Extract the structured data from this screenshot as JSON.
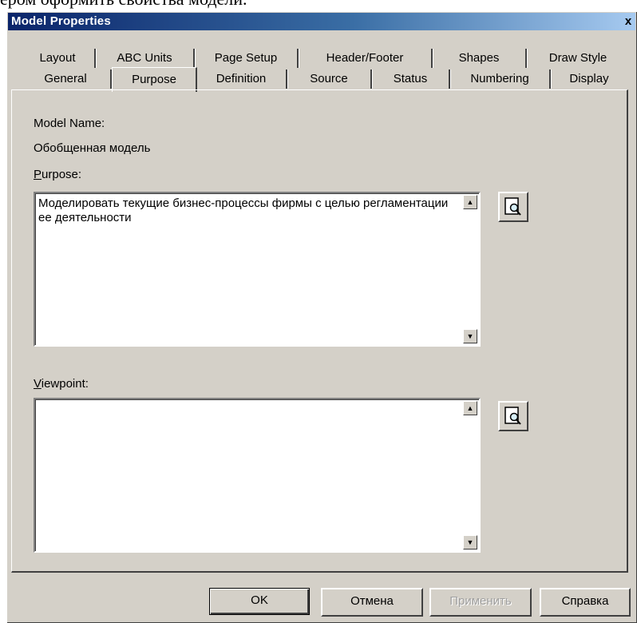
{
  "page_caption": "ером оформить свойства модели.",
  "dialog": {
    "title": "Model Properties",
    "close_glyph": "x"
  },
  "tabs": {
    "row_back": [
      "Layout",
      "ABC Units",
      "Page Setup",
      "Header/Footer",
      "Shapes",
      "Draw Style"
    ],
    "row_front": [
      "General",
      "Purpose",
      "Definition",
      "Source",
      "Status",
      "Numbering",
      "Display"
    ],
    "active": "Purpose"
  },
  "model_name": {
    "label": "Model Name:",
    "value": "Обобщенная модель"
  },
  "purpose": {
    "label_mnemonic": "P",
    "label_rest": "urpose:",
    "text": "Моделировать текущие бизнес-процессы фирмы с целью регламентации ее деятельности",
    "browse_icon": "magnifier-document-icon"
  },
  "viewpoint": {
    "label_mnemonic": "V",
    "label_rest": "iewpoint:",
    "text": "",
    "browse_icon": "magnifier-document-icon"
  },
  "buttons": {
    "ok": "OK",
    "cancel": "Отмена",
    "apply": "Применить",
    "help": "Справка"
  },
  "colors": {
    "face": "#d4d0c8",
    "title_bar": "#0a246a"
  }
}
